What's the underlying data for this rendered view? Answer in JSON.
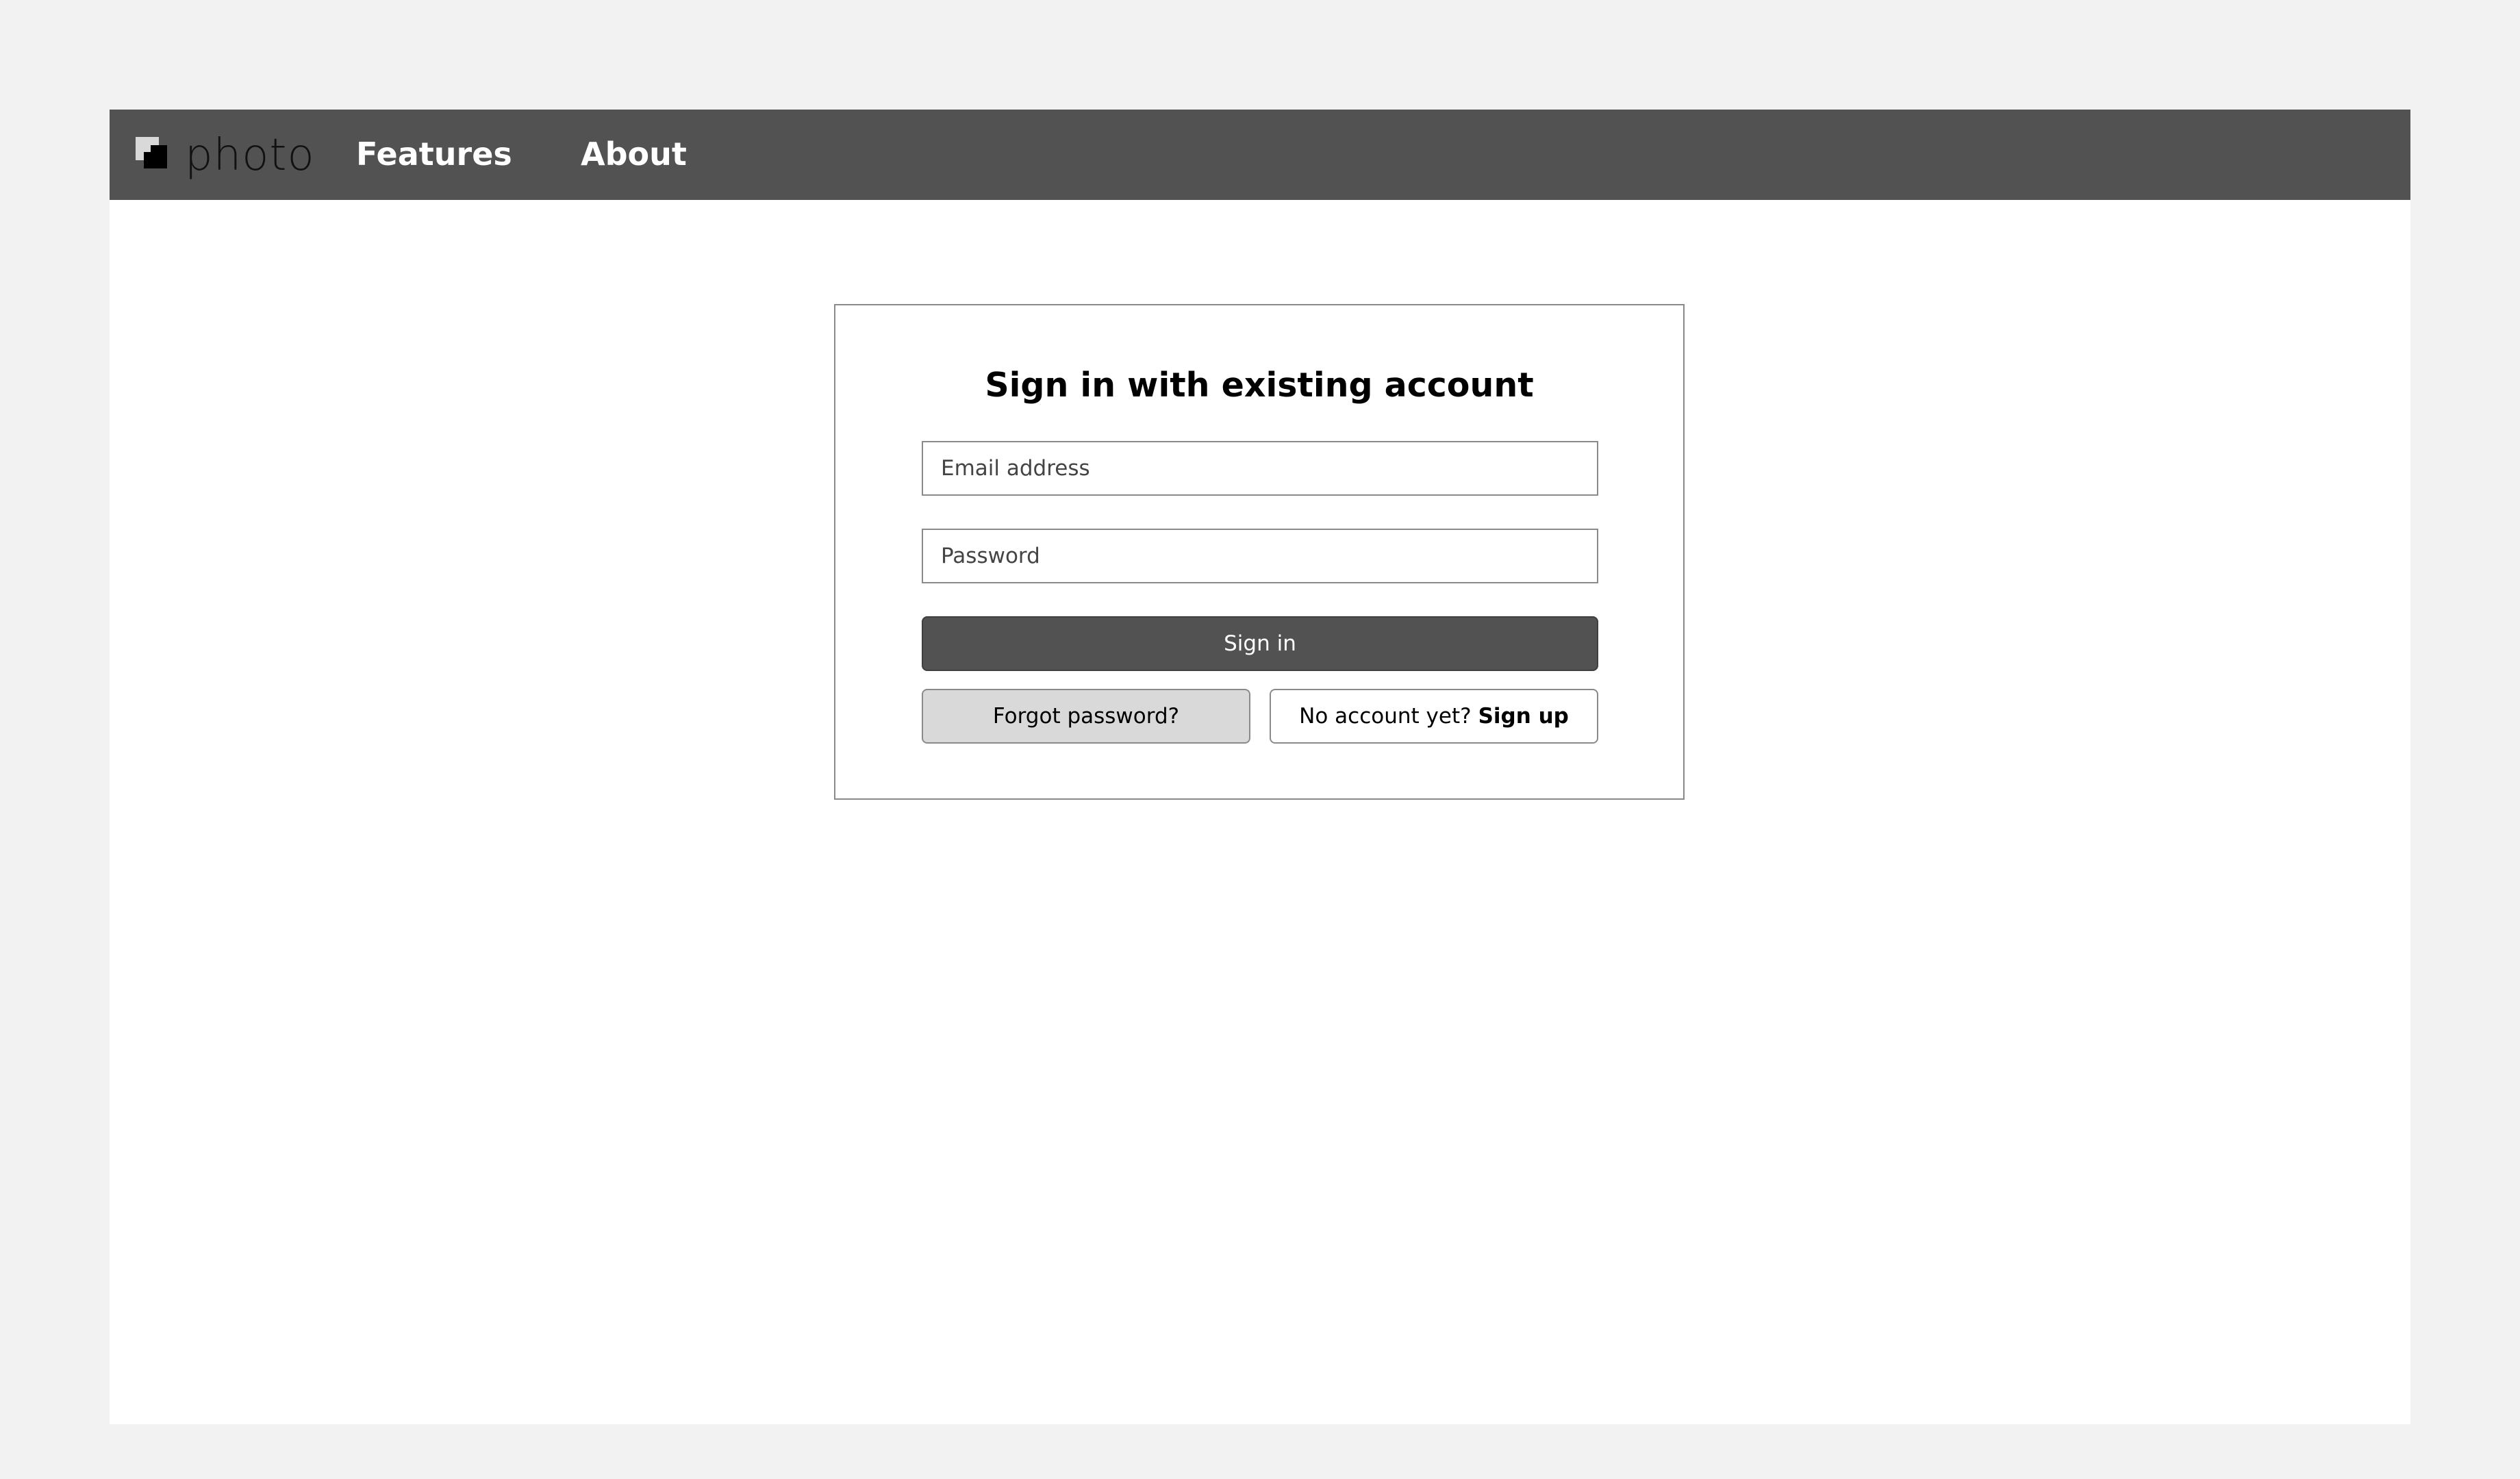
{
  "nav": {
    "logo_text": "photo",
    "logo_icon": "layered-squares-icon",
    "links": [
      {
        "label": "Features"
      },
      {
        "label": "About"
      }
    ]
  },
  "signin": {
    "title": "Sign in with existing account",
    "email": {
      "placeholder": "Email address",
      "value": ""
    },
    "password": {
      "placeholder": "Password",
      "value": ""
    },
    "signin_label": "Sign in",
    "forgot_label": "Forgot password?",
    "signup_prompt": "No account yet?",
    "signup_label": "Sign up"
  },
  "colors": {
    "navbar": "#525252",
    "page_background": "#f2f2f2",
    "primary_button": "#525252",
    "secondary_button": "#d9d9d9"
  }
}
